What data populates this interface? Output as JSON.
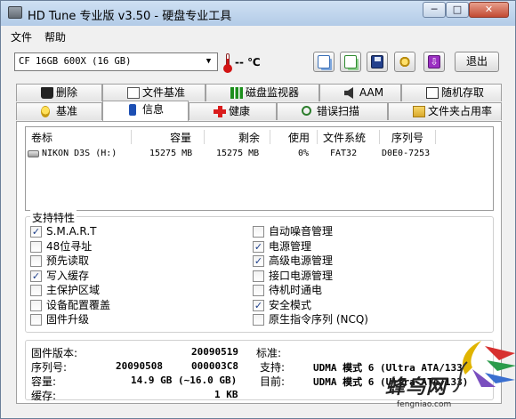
{
  "window": {
    "title": "HD Tune 专业版 v3.50 - 硬盘专业工具"
  },
  "window_controls": {
    "minimize": "─",
    "maximize": "□",
    "close": "✕"
  },
  "menu": [
    "文件",
    "帮助"
  ],
  "toolbar": {
    "drive": "CF 16GB 600X (16 GB)",
    "temperature": "-- ℃",
    "exit_label": "退出",
    "icons": [
      "copy-text-icon",
      "copy-screenshot-icon",
      "save-icon",
      "options-icon",
      "download-icon"
    ]
  },
  "tabs_row1": [
    "删除",
    "文件基准",
    "磁盘监视器",
    "AAM",
    "随机存取"
  ],
  "tabs_row2": [
    "基准",
    "信息",
    "健康",
    "错误扫描",
    "文件夹占用率"
  ],
  "active_tab": "信息",
  "partition_table": {
    "columns": [
      "卷标",
      "容量",
      "剩余",
      "使用",
      "文件系统",
      "序列号"
    ],
    "rows": [
      {
        "label": "NIKON D3S (H:)",
        "capacity": "15275 MB",
        "free": "15275 MB",
        "used": "0%",
        "fs": "FAT32",
        "serial": "D0E0-7253"
      }
    ]
  },
  "features": {
    "title": "支持特性",
    "left": [
      {
        "label": "S.M.A.R.T",
        "checked": true
      },
      {
        "label": "48位寻址",
        "checked": false
      },
      {
        "label": "预先读取",
        "checked": false
      },
      {
        "label": "写入缓存",
        "checked": true
      },
      {
        "label": "主保护区域",
        "checked": false
      },
      {
        "label": "设备配置覆盖",
        "checked": false
      },
      {
        "label": "固件升级",
        "checked": false
      }
    ],
    "right": [
      {
        "label": "自动噪音管理",
        "checked": false
      },
      {
        "label": "电源管理",
        "checked": true
      },
      {
        "label": "高级电源管理",
        "checked": true
      },
      {
        "label": "接口电源管理",
        "checked": false
      },
      {
        "label": "待机时通电",
        "checked": false
      },
      {
        "label": "安全模式",
        "checked": true
      },
      {
        "label": "原生指令序列 (NCQ)",
        "checked": false
      }
    ]
  },
  "info": {
    "firmware_label": "固件版本:",
    "firmware": "20090519",
    "serial_label": "序列号:",
    "serial_a": "20090508",
    "serial_b": "000003C8",
    "capacity_label": "容量:",
    "capacity": "14.9 GB (~16.0 GB)",
    "cache_label": "缓存:",
    "cache": "1 KB",
    "standard_label": "标准:",
    "supported_label": "支持:",
    "supported": "UDMA 模式 6 (Ultra ATA/133)",
    "current_label": "目前:",
    "current": "UDMA 模式 6 (Ultra ATA/133)"
  },
  "watermark": {
    "text": "蜂鸟网",
    "url": "fengniao.com"
  }
}
